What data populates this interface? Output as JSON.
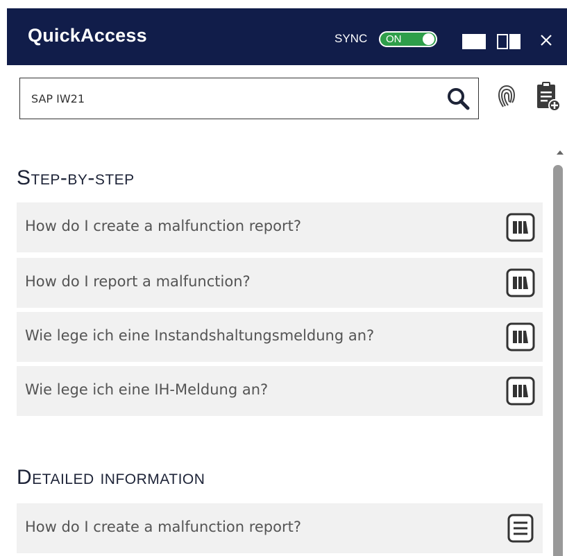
{
  "header": {
    "title": "QuickAccess",
    "sync_label": "SYNC",
    "sync_toggle": "ON",
    "window_buttons": [
      "full-view-icon",
      "split-view-icon",
      "close-icon"
    ]
  },
  "search": {
    "value": "SAP IW21",
    "icons": [
      "search-icon",
      "fingerprint-icon",
      "clipboard-add-icon"
    ]
  },
  "sections": {
    "step_by_step": {
      "title": "Step-by-step",
      "items": [
        {
          "label": "How do I create a malfunction report?",
          "icon": "book-icon"
        },
        {
          "label": "How do I report a malfunction?",
          "icon": "book-icon"
        },
        {
          "label": "Wie lege ich eine Instandshaltungsmeldung an?",
          "icon": "book-icon"
        },
        {
          "label": "Wie lege ich eine IH-Meldung an?",
          "icon": "book-icon"
        }
      ]
    },
    "detailed_information": {
      "title": "Detailed information",
      "items": [
        {
          "label": "How do I create a malfunction report?",
          "icon": "document-icon"
        }
      ]
    }
  },
  "colors": {
    "header_bg": "#111d4a",
    "toggle_on": "#2e9e4a",
    "item_bg": "#f1f1f1"
  }
}
